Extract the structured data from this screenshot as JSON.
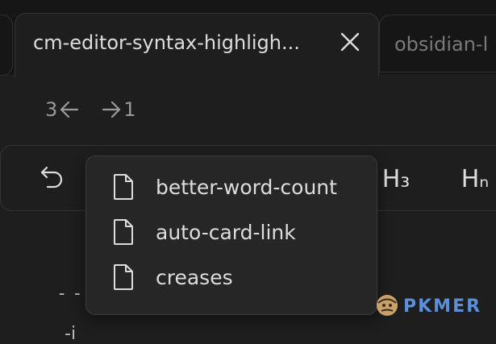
{
  "tabs": [
    {
      "title": "cm-editor-syntax-highligh...",
      "active": true,
      "close_icon": "close-icon"
    },
    {
      "title": "obsidian-l",
      "active": false
    }
  ],
  "history": {
    "back_count": "3",
    "forward_count": "1",
    "back_icon": "arrow-left-icon",
    "forward_icon": "arrow-right-icon"
  },
  "toolbar": {
    "undo_icon": "undo-icon",
    "h3_label": "H₃",
    "hn_label": "Hₙ"
  },
  "popup": {
    "items": [
      {
        "label": "better-word-count",
        "icon": "file-icon"
      },
      {
        "label": "auto-card-link",
        "icon": "file-icon"
      },
      {
        "label": "creases",
        "icon": "file-icon"
      }
    ]
  },
  "editor": {
    "line1": "--",
    "line2": "-i"
  },
  "watermark": {
    "brand": "PKMER",
    "brand_color": "#5b8fd8",
    "mascot_color": "#c9a26a"
  }
}
